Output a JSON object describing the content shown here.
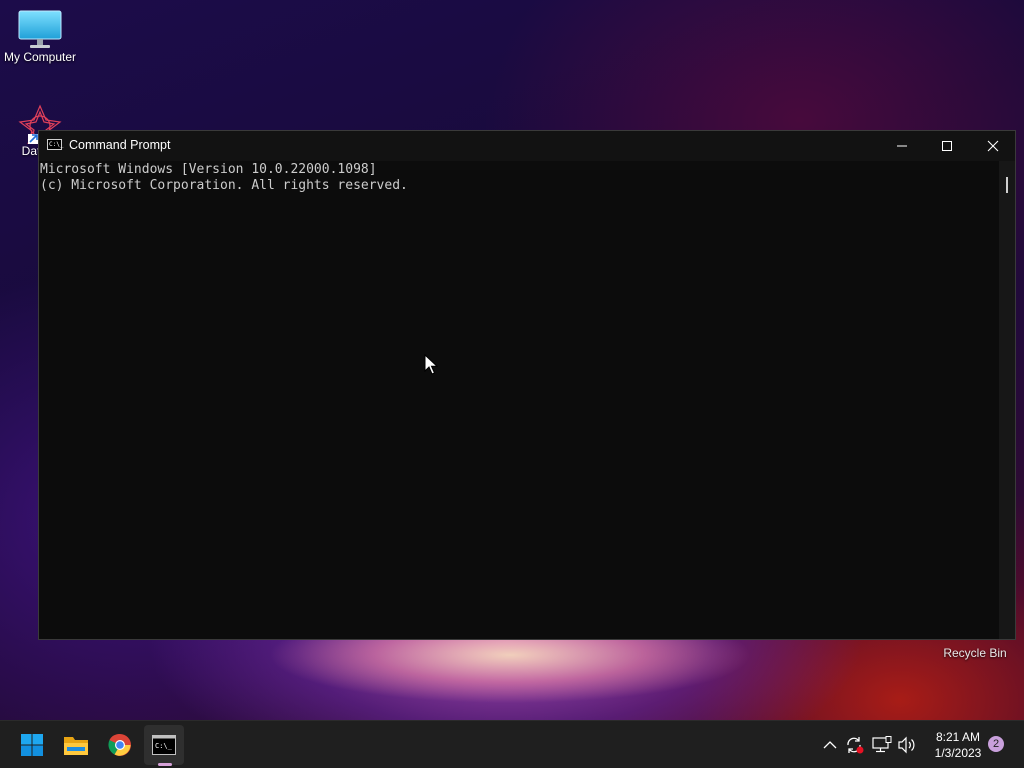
{
  "desktop": {
    "icons": [
      {
        "label": "My Computer"
      },
      {
        "label": "DataW"
      }
    ],
    "recycle_bin_label": "Recycle Bin"
  },
  "cmd_window": {
    "title": "Command Prompt",
    "icon_glyph": "C:\\_",
    "lines": [
      "Microsoft Windows [Version 10.0.22000.1098]",
      "(c) Microsoft Corporation. All rights reserved."
    ],
    "controls": [
      "minimize-icon",
      "maximize-icon",
      "close-icon"
    ]
  },
  "taskbar": {
    "apps": [
      "windows-start-icon",
      "file-explorer-icon",
      "chrome-icon",
      "command-prompt-icon"
    ],
    "tray": [
      "chevron-up-icon",
      "sync-icon",
      "network-icon",
      "volume-icon"
    ],
    "time": "8:21 AM",
    "date": "1/3/2023",
    "notification_count": "2"
  },
  "colors": {
    "taskbar_bg": "#1f1f1f",
    "console_bg": "#0c0c0c",
    "console_text": "#cccccc",
    "accent": "#c9a0dc"
  }
}
